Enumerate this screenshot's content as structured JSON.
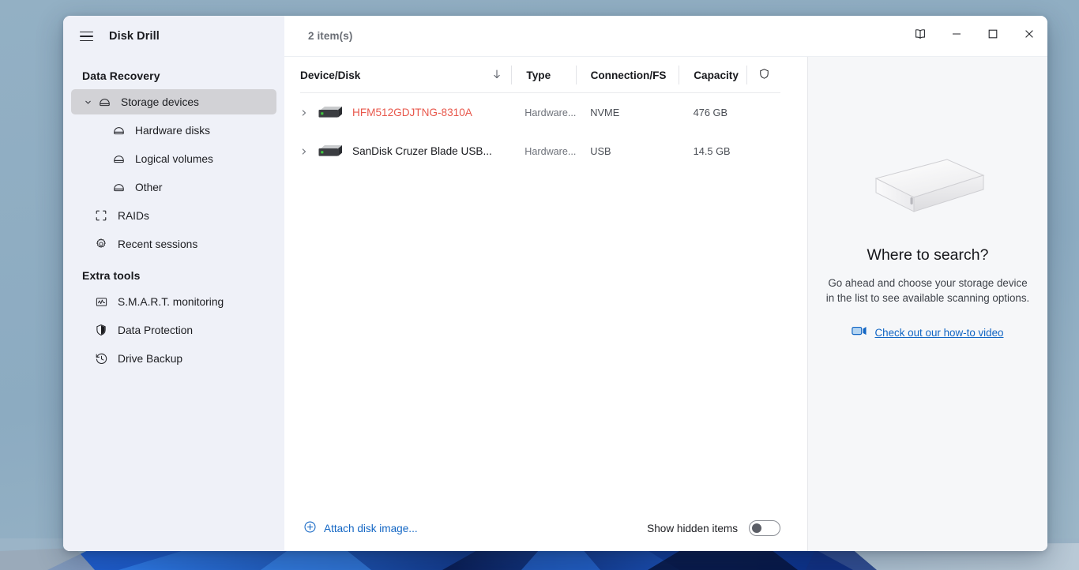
{
  "window": {
    "app_title": "Disk Drill",
    "item_count": "2 item(s)",
    "menu_icon": "hamburger-icon",
    "controls": [
      {
        "name": "help-book-button",
        "icon": "book-icon",
        "label": ""
      },
      {
        "name": "minimize-button",
        "icon": "minimize-icon",
        "label": ""
      },
      {
        "name": "maximize-button",
        "icon": "maximize-icon",
        "label": ""
      },
      {
        "name": "close-button",
        "icon": "close-icon",
        "label": ""
      }
    ]
  },
  "sidebar": {
    "sections": [
      {
        "title": "Data Recovery",
        "items": [
          {
            "label": "Storage devices",
            "icon": "disk-icon",
            "level": 1,
            "expanded": true,
            "selected": true
          },
          {
            "label": "Hardware disks",
            "icon": "disk-icon",
            "level": 2,
            "selected": false
          },
          {
            "label": "Logical volumes",
            "icon": "disk-icon",
            "level": 2,
            "selected": false
          },
          {
            "label": "Other",
            "icon": "disk-icon",
            "level": 2,
            "selected": false
          },
          {
            "label": "RAIDs",
            "icon": "raid-icon",
            "level": 1,
            "selected": false
          },
          {
            "label": "Recent sessions",
            "icon": "gear-icon",
            "level": 1,
            "selected": false
          }
        ]
      },
      {
        "title": "Extra tools",
        "items": [
          {
            "label": "S.M.A.R.T. monitoring",
            "icon": "smart-monitor-icon",
            "level": 1,
            "selected": false
          },
          {
            "label": "Data Protection",
            "icon": "shield-half-icon",
            "level": 1,
            "selected": false
          },
          {
            "label": "Drive Backup",
            "icon": "clock-history-icon",
            "level": 1,
            "selected": false
          }
        ]
      }
    ]
  },
  "table": {
    "columns": [
      {
        "key": "device",
        "label": "Device/Disk",
        "sorted": true,
        "sort_icon": "arrow-down-icon"
      },
      {
        "key": "type",
        "label": "Type"
      },
      {
        "key": "connection",
        "label": "Connection/FS"
      },
      {
        "key": "capacity",
        "label": "Capacity"
      },
      {
        "key": "protection",
        "label": "",
        "icon": "shield-icon"
      }
    ],
    "rows": [
      {
        "name": "HFM512GDJTNG-8310A",
        "type": "Hardware...",
        "connection": "NVME",
        "capacity": "476 GB",
        "warning": true,
        "expand_icon": "chevron-right-icon",
        "disk_icon": "hdd-icon"
      },
      {
        "name": "SanDisk Cruzer Blade USB...",
        "type": "Hardware...",
        "connection": "USB",
        "capacity": "14.5 GB",
        "warning": false,
        "expand_icon": "chevron-right-icon",
        "disk_icon": "hdd-icon"
      }
    ]
  },
  "bottom_bar": {
    "attach_label": "Attach disk image...",
    "attach_icon": "plus-circle-icon",
    "hidden_items_label": "Show hidden items",
    "hidden_items_on": false
  },
  "right_panel": {
    "illustration": "external-drive-illustration",
    "title": "Where to search?",
    "description": "Go ahead and choose your storage device in the list to see available scanning options.",
    "link_text": "Check out our how-to video",
    "link_icon": "video-camera-icon"
  },
  "colors": {
    "accent_link": "#1266c4",
    "warning_text": "#e8584c",
    "sidebar_bg": "#eff1f8",
    "sidebar_selected": "#d2d2d6",
    "right_panel_bg": "#f6f7f9",
    "desktop_bg": "#8fadc2",
    "disk_led": "#3ec63e"
  }
}
